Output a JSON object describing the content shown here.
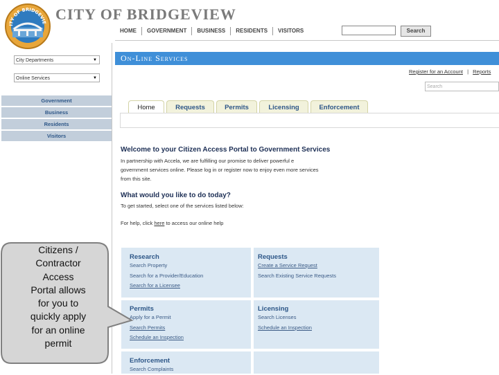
{
  "header": {
    "logo_text": "CITY OF BRIDGEVIEW",
    "city_title": "CITY OF BRIDGEVIEW",
    "nav": [
      "HOME",
      "GOVERNMENT",
      "BUSINESS",
      "RESIDENTS",
      "VISITORS"
    ],
    "search_button": "Search",
    "search_value": ""
  },
  "sidebar": {
    "selects": [
      "City Departments",
      "Online Services"
    ],
    "nav": [
      "Government",
      "Business",
      "Residents",
      "Visitors"
    ]
  },
  "banner": {
    "title": "On-Line Services"
  },
  "account": {
    "register": "Register for an Account",
    "separator": "|",
    "reports": "Reports",
    "search_placeholder": "Search"
  },
  "tabs": [
    "Home",
    "Requests",
    "Permits",
    "Licensing",
    "Enforcement"
  ],
  "welcome": {
    "heading": "Welcome to your Citizen Access Portal to Government Services",
    "body_lines": [
      "In partnership with Accela, we are fulfilling our promise to deliver powerful e",
      "government services online. Please log in or register now to enjoy even more services",
      "from this site."
    ],
    "question": "What would you like to do today?",
    "instruction": "To get started, select one of the services listed below:",
    "help_prefix": "For help, click ",
    "help_link": "here",
    "help_suffix": " to access our online help"
  },
  "services": {
    "research": {
      "title": "Research",
      "links": [
        "Search Property",
        "Search for a Provider/Education",
        "Search for a Licensee"
      ]
    },
    "requests": {
      "title": "Requests",
      "links": [
        "Create a Service Request",
        "Search Existing Service Requests"
      ]
    },
    "permits": {
      "title": "Permits",
      "links": [
        "Apply for a Permit",
        "Search Permits",
        "Schedule an Inspection"
      ]
    },
    "licensing": {
      "title": "Licensing",
      "links": [
        "Search Licenses",
        "Schedule an Inspection"
      ]
    },
    "enforcement": {
      "title": "Enforcement",
      "links": [
        "Search Complaints"
      ]
    }
  },
  "callout": {
    "lines": [
      "Citizens /",
      "Contractor",
      "Access",
      "Portal allows",
      "for you to",
      "quickly apply",
      "for an online",
      "permit"
    ]
  },
  "colors": {
    "banner": "#3f8fd8",
    "sidebar_item": "#c2cedb",
    "service_box": "#dbe8f3",
    "tab": "#f2f2dc",
    "link_blue": "#2d5687",
    "callout_fill": "#d6d6d6"
  }
}
